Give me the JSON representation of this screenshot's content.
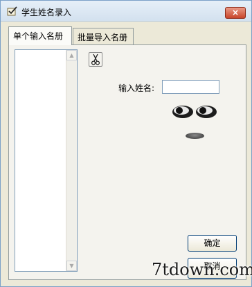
{
  "window": {
    "title": "学生姓名录入",
    "close_glyph": "×"
  },
  "tabs": [
    {
      "label": "单个输入名册",
      "active": true
    },
    {
      "label": "批量导入名册",
      "active": false
    }
  ],
  "form": {
    "name_label": "输入姓名:",
    "name_value": "",
    "ok_label": "确定",
    "cancel_label": "取消"
  },
  "listbox": {
    "items": [],
    "scroll_up_glyph": "▲",
    "scroll_down_glyph": "▼"
  },
  "watermark": "7tdown.com",
  "icons": {
    "app": "checkmark-pen-icon",
    "tool": "scissors-icon"
  }
}
